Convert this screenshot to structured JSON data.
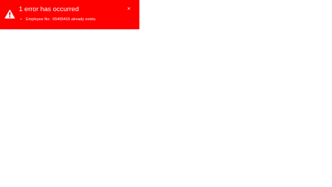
{
  "error_banner": {
    "icon": "warning-icon",
    "title": "1 error has occurred",
    "close_icon": "close-icon",
    "close_label": "×",
    "messages": [
      "Employee No : 65465415 already exists."
    ],
    "colors": {
      "background": "#fe0000",
      "text": "#ffffff"
    }
  }
}
